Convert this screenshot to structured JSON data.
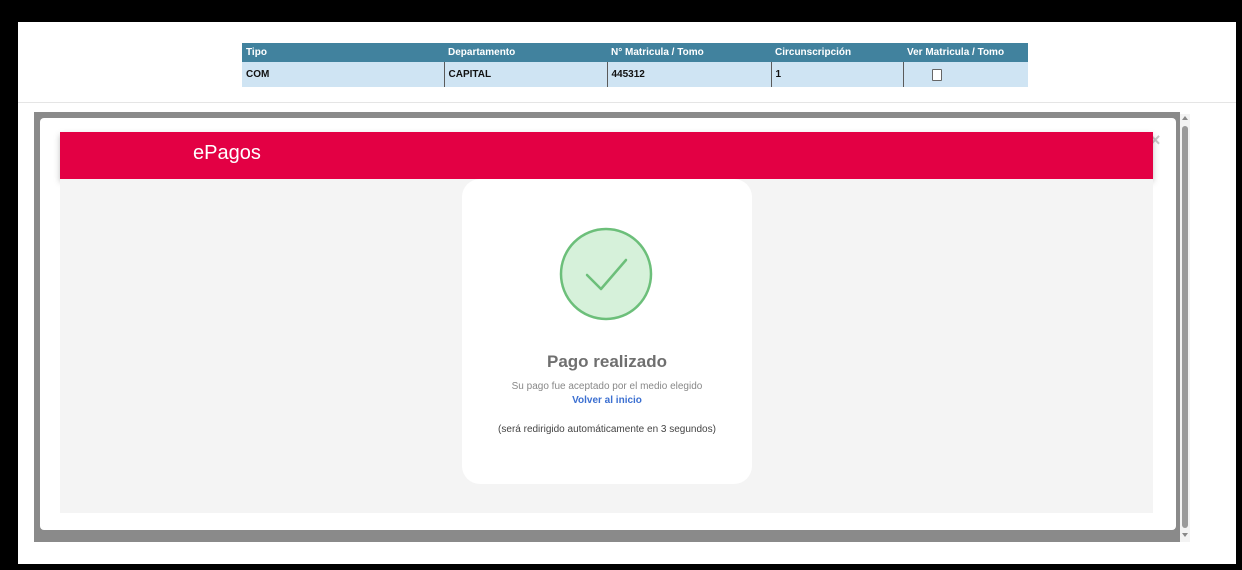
{
  "table": {
    "headers": [
      "Tipo",
      "Departamento",
      "N° Matricula / Tomo",
      "Circunscripción",
      "Ver Matricula / Tomo"
    ],
    "row": {
      "tipo": "COM",
      "departamento": "CAPITAL",
      "matricula": "445312",
      "circunscripcion": "1"
    }
  },
  "modal": {
    "close": "×",
    "brand": "ePagos",
    "status_title": "Pago realizado",
    "status_subtitle": "Su pago fue aceptado por el medio elegido",
    "link_label": "Volver al inicio",
    "redirect_note": "(será redirigido automáticamente en 3 segundos)"
  },
  "colors": {
    "brand_bar": "#e30044",
    "table_header": "#41829e",
    "table_row": "#cfe4f3",
    "success_fill": "#d6f1da",
    "success_stroke": "#6cbf7a"
  },
  "icons": {
    "view_doc": "document-icon",
    "success": "check-circle-icon",
    "close": "close-icon"
  }
}
